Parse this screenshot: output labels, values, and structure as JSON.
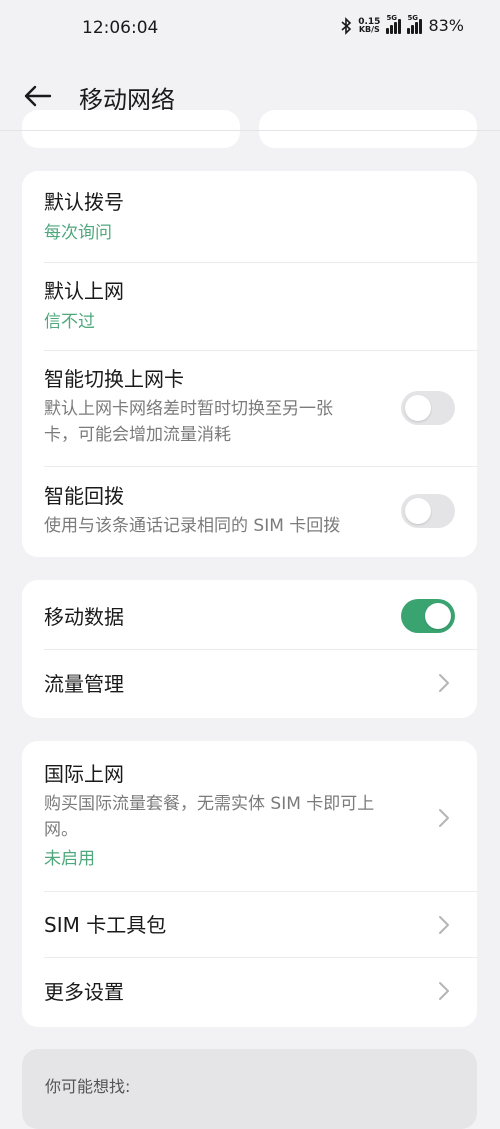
{
  "status_bar": {
    "time": "12:06:04",
    "speed_value": "0.15",
    "speed_unit": "KB/S",
    "sim1_tag": "5G",
    "sim2_tag": "5G",
    "battery": "83%"
  },
  "header": {
    "title": "移动网络"
  },
  "sim_settings": {
    "default_dial": {
      "title": "默认拨号",
      "value": "每次询问"
    },
    "default_data": {
      "title": "默认上网",
      "value": "信不过"
    },
    "smart_switch": {
      "title": "智能切换上网卡",
      "desc_line1": "默认上网卡网络差时暂时切换至另一张",
      "desc_line2": "卡，可能会增加流量消耗",
      "enabled": false
    },
    "smart_callback": {
      "title": "智能回拨",
      "desc": "使用与该条通话记录相同的 SIM 卡回拨",
      "enabled": false
    }
  },
  "data_settings": {
    "mobile_data": {
      "title": "移动数据",
      "enabled": true
    },
    "data_management": {
      "title": "流量管理"
    }
  },
  "more_settings": {
    "international": {
      "title": "国际上网",
      "desc_line1": "购买国际流量套餐，无需实体 SIM 卡即可上",
      "desc_line2": "网。",
      "status": "未启用"
    },
    "sim_toolkit": {
      "title": "SIM 卡工具包"
    },
    "more": {
      "title": "更多设置"
    }
  },
  "suggestions": {
    "label": "你可能想找:"
  },
  "colors": {
    "accent": "#3aa471",
    "accent_text": "#4fa87d",
    "background": "#f2f2f4"
  }
}
